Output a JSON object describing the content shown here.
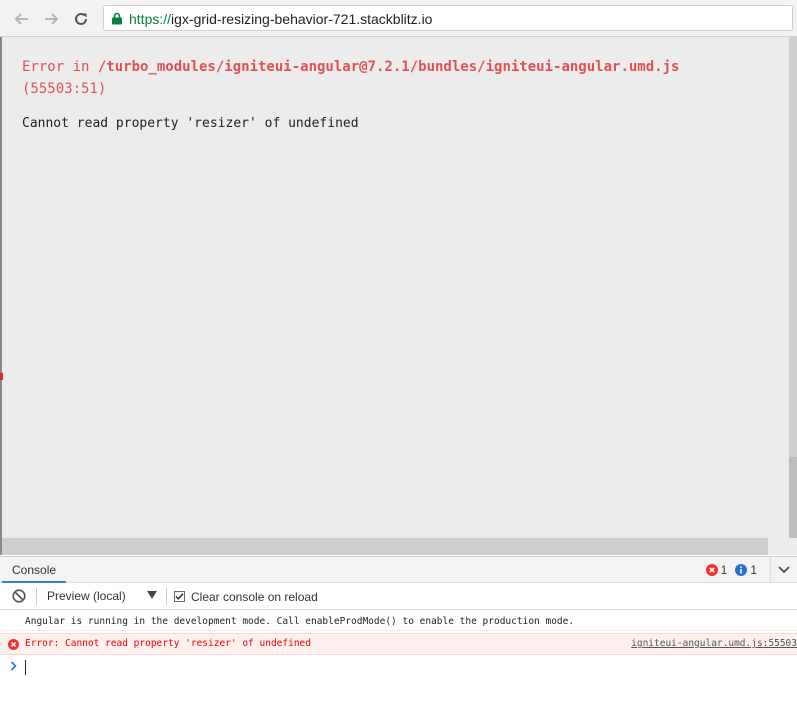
{
  "browser": {
    "url_scheme": "https://",
    "url_host": "igx-grid-resizing-behavior-721.stackblitz.io",
    "back_icon": "arrow-left-icon",
    "forward_icon": "arrow-right-icon",
    "reload_icon": "reload-icon",
    "lock_icon": "lock-icon"
  },
  "page": {
    "error_prefix": "Error in ",
    "error_path": "/turbo_modules/igniteui-angular@7.2.1/bundles/igniteui-angular.umd.js",
    "error_location": "(55503:51)",
    "error_message": "Cannot read property 'resizer' of undefined"
  },
  "console": {
    "tab_label": "Console",
    "error_count": "1",
    "info_count": "1",
    "context_label": "Preview (local)",
    "clear_on_reload_label": "Clear console on reload",
    "clear_on_reload_checked": true,
    "messages": {
      "info": "Angular is running in the development mode. Call enableProdMode() to enable the production mode.",
      "error": "Error: Cannot read property 'resizer' of undefined",
      "error_source": "igniteui-angular.umd.js:55503"
    },
    "input_value": ""
  },
  "colors": {
    "error_red": "#e05252",
    "secure_green": "#0b8043",
    "tab_accent": "#3879d9"
  }
}
